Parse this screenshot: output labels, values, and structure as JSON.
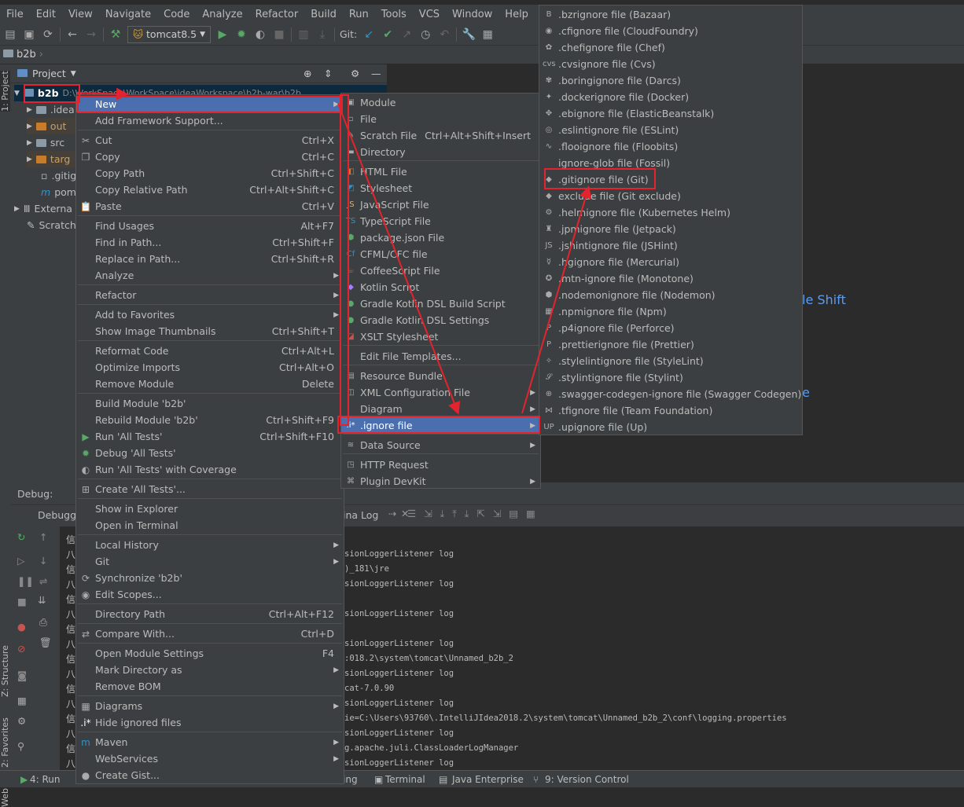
{
  "menubar": [
    "File",
    "Edit",
    "View",
    "Navigate",
    "Code",
    "Analyze",
    "Refactor",
    "Build",
    "Run",
    "Tools",
    "VCS",
    "Window",
    "Help"
  ],
  "toolbar": {
    "run_config": "tomcat8.5",
    "git_label": "Git:"
  },
  "breadcrumb": "b2b",
  "left_tabs": {
    "project": "1: Project",
    "structure": "Z: Structure",
    "favorites": "2: Favorites",
    "web": "Web"
  },
  "project_panel": {
    "title": "Project",
    "root": {
      "name": "b2b",
      "path": "D:\\WorkSpace\\WorkSpace\\ideaWorkspace\\b2b-war\\b2b"
    },
    "items": [
      ".idea",
      "out",
      "src",
      "targ",
      ".gitig",
      "pom",
      "Externa",
      "Scratch"
    ]
  },
  "context_menu": [
    {
      "label": "New",
      "shortcut": "",
      "submenu": true,
      "icon": ""
    },
    {
      "label": "Add Framework Support...",
      "shortcut": "",
      "icon": ""
    },
    {
      "label": "Cut",
      "shortcut": "Ctrl+X",
      "icon": "scissors-icon"
    },
    {
      "label": "Copy",
      "shortcut": "Ctrl+C",
      "icon": "copy-icon"
    },
    {
      "label": "Copy Path",
      "shortcut": "Ctrl+Shift+C",
      "icon": ""
    },
    {
      "label": "Copy Relative Path",
      "shortcut": "Ctrl+Alt+Shift+C",
      "icon": ""
    },
    {
      "label": "Paste",
      "shortcut": "Ctrl+V",
      "icon": "paste-icon"
    },
    {
      "label": "Find Usages",
      "shortcut": "Alt+F7",
      "icon": ""
    },
    {
      "label": "Find in Path...",
      "shortcut": "Ctrl+Shift+F",
      "icon": ""
    },
    {
      "label": "Replace in Path...",
      "shortcut": "Ctrl+Shift+R",
      "icon": ""
    },
    {
      "label": "Analyze",
      "shortcut": "",
      "submenu": true,
      "icon": ""
    },
    {
      "label": "Refactor",
      "shortcut": "",
      "submenu": true,
      "icon": ""
    },
    {
      "label": "Add to Favorites",
      "shortcut": "",
      "submenu": true,
      "icon": ""
    },
    {
      "label": "Show Image Thumbnails",
      "shortcut": "Ctrl+Shift+T",
      "icon": ""
    },
    {
      "label": "Reformat Code",
      "shortcut": "Ctrl+Alt+L",
      "icon": ""
    },
    {
      "label": "Optimize Imports",
      "shortcut": "Ctrl+Alt+O",
      "icon": ""
    },
    {
      "label": "Remove Module",
      "shortcut": "Delete",
      "icon": ""
    },
    {
      "label": "Build Module 'b2b'",
      "shortcut": "",
      "icon": ""
    },
    {
      "label": "Rebuild Module 'b2b'",
      "shortcut": "Ctrl+Shift+F9",
      "icon": ""
    },
    {
      "label": "Run 'All Tests'",
      "shortcut": "Ctrl+Shift+F10",
      "icon": "run-icon"
    },
    {
      "label": "Debug 'All Tests'",
      "shortcut": "",
      "icon": "debug-icon"
    },
    {
      "label": "Run 'All Tests' with Coverage",
      "shortcut": "",
      "icon": "coverage-icon"
    },
    {
      "label": "Create 'All Tests'...",
      "shortcut": "",
      "icon": "create-icon"
    },
    {
      "label": "Show in Explorer",
      "shortcut": "",
      "icon": ""
    },
    {
      "label": "Open in Terminal",
      "shortcut": "",
      "icon": ""
    },
    {
      "label": "Local History",
      "shortcut": "",
      "submenu": true,
      "icon": ""
    },
    {
      "label": "Git",
      "shortcut": "",
      "submenu": true,
      "icon": ""
    },
    {
      "label": "Synchronize 'b2b'",
      "shortcut": "",
      "icon": "sync-icon"
    },
    {
      "label": "Edit Scopes...",
      "shortcut": "",
      "icon": "scope-icon"
    },
    {
      "label": "Directory Path",
      "shortcut": "Ctrl+Alt+F12",
      "icon": ""
    },
    {
      "label": "Compare With...",
      "shortcut": "Ctrl+D",
      "icon": "compare-icon"
    },
    {
      "label": "Open Module Settings",
      "shortcut": "F4",
      "icon": ""
    },
    {
      "label": "Mark Directory as",
      "shortcut": "",
      "submenu": true,
      "icon": ""
    },
    {
      "label": "Remove BOM",
      "shortcut": "",
      "icon": ""
    },
    {
      "label": "Diagrams",
      "shortcut": "",
      "submenu": true,
      "icon": "diagram-icon"
    },
    {
      "label": "Hide ignored files",
      "shortcut": "",
      "icon": "ignore-icon"
    },
    {
      "label": "Maven",
      "shortcut": "",
      "submenu": true,
      "icon": "maven-icon"
    },
    {
      "label": "WebServices",
      "shortcut": "",
      "submenu": true,
      "icon": ""
    },
    {
      "label": "Create Gist...",
      "shortcut": "",
      "icon": "github-icon"
    }
  ],
  "new_menu": [
    {
      "label": "Module",
      "shortcut": "",
      "icon": "module-icon"
    },
    {
      "label": "File",
      "shortcut": "",
      "icon": "file-icon"
    },
    {
      "label": "Scratch File",
      "shortcut": "Ctrl+Alt+Shift+Insert",
      "icon": "scratch-icon"
    },
    {
      "label": "Directory",
      "shortcut": "",
      "icon": "folder-icon"
    },
    {
      "label": "HTML File",
      "shortcut": "",
      "icon": "html-icon"
    },
    {
      "label": "Stylesheet",
      "shortcut": "",
      "icon": "css-icon"
    },
    {
      "label": "JavaScript File",
      "shortcut": "",
      "icon": "js-icon"
    },
    {
      "label": "TypeScript File",
      "shortcut": "",
      "icon": "ts-icon"
    },
    {
      "label": "package.json File",
      "shortcut": "",
      "icon": "npm-icon"
    },
    {
      "label": "CFML/CFC file",
      "shortcut": "",
      "icon": "cf-icon"
    },
    {
      "label": "CoffeeScript File",
      "shortcut": "",
      "icon": "coffee-icon"
    },
    {
      "label": "Kotlin Script",
      "shortcut": "",
      "icon": "kotlin-icon"
    },
    {
      "label": "Gradle Kotlin DSL Build Script",
      "shortcut": "",
      "icon": "gradle-icon"
    },
    {
      "label": "Gradle Kotlin DSL Settings",
      "shortcut": "",
      "icon": "gradle-icon"
    },
    {
      "label": "XSLT Stylesheet",
      "shortcut": "",
      "icon": "xslt-icon"
    },
    {
      "label": "Edit File Templates...",
      "shortcut": "",
      "icon": ""
    },
    {
      "label": "Resource Bundle",
      "shortcut": "",
      "icon": "bundle-icon"
    },
    {
      "label": "XML Configuration File",
      "shortcut": "",
      "submenu": true,
      "icon": "xml-icon"
    },
    {
      "label": "Diagram",
      "shortcut": "",
      "submenu": true,
      "icon": ""
    },
    {
      "label": ".ignore file",
      "shortcut": "",
      "submenu": true,
      "icon": "ignore-icon",
      "selected": true
    },
    {
      "label": "Data Source",
      "shortcut": "",
      "submenu": true,
      "icon": "database-icon"
    },
    {
      "label": "HTTP Request",
      "shortcut": "",
      "icon": "api-icon"
    },
    {
      "label": "Plugin DevKit",
      "shortcut": "",
      "submenu": true,
      "icon": "plugin-icon"
    }
  ],
  "ignore_menu": [
    ".bzrignore file (Bazaar)",
    ".cfignore file (CloudFoundry)",
    ".chefignore file (Chef)",
    ".cvsignore file (Cvs)",
    ".boringignore file (Darcs)",
    ".dockerignore file (Docker)",
    ".ebignore file (ElasticBeanstalk)",
    ".eslintignore file (ESLint)",
    ".flooignore file (Floobits)",
    "ignore-glob file (Fossil)",
    ".gitignore file (Git)",
    "exclude file (Git exclude)",
    ".helmignore file (Kubernetes Helm)",
    ".jpmignore file (Jetpack)",
    ".jshintignore file (JSHint)",
    ".hgignore file (Mercurial)",
    ".mtn-ignore file (Monotone)",
    ".nodemonignore file (Nodemon)",
    ".npmignore file (Npm)",
    ".p4ignore file (Perforce)",
    ".prettierignore file (Prettier)",
    ".stylelintignore file (StyleLint)",
    ".stylintignore file (Stylint)",
    ".swagger-codegen-ignore file (Swagger Codegen)",
    ".tfignore file (Team Foundation)",
    ".upignore file (Up)"
  ],
  "ignore_icons": [
    "B",
    "◉",
    "✿",
    "cvs",
    "✾",
    "✦",
    "✥",
    "◎",
    "∿",
    "",
    "◆",
    "◆",
    "⚙",
    "♜",
    "JS",
    "☿",
    "✪",
    "⬢",
    "▦",
    "P",
    "P",
    "✧",
    "𝒮",
    "⊕",
    "⋈",
    "UP"
  ],
  "editor_hints": {
    "hint1": "le Shift",
    "hint2": "e"
  },
  "debug": {
    "label": "Debug:",
    "tab": "Debugge",
    "log_tab": "ina Log"
  },
  "console_lines": [
    "sionLoggerListener log",
    ")_181\\jre",
    "sionLoggerListener log",
    "",
    "sionLoggerListener log",
    "",
    "sionLoggerListener log",
    ":018.2\\system\\tomcat\\Unnamed_b2b_2",
    "sionLoggerListener log",
    "cat-7.0.90",
    "sionLoggerListener log",
    "ie=C:\\Users\\93760\\.IntelliJIdea2018.2\\system\\tomcat\\Unnamed_b2b_2\\conf\\logging.properties",
    "sionLoggerListener log",
    "g.apache.juli.ClassLoaderLogManager",
    "sionLoggerListener log"
  ],
  "console_prefix": [
    "信",
    "八",
    "信",
    "八",
    "信",
    "八",
    "信",
    "八",
    "信",
    "八",
    "信",
    "八",
    "信",
    "八",
    "信",
    "八"
  ],
  "statusbar": {
    "run": "4: Run",
    "logging": "ing",
    "terminal": "Terminal",
    "java_enterprise": "Java Enterprise",
    "vcs": "9: Version Control"
  },
  "colors": {
    "selection": "#4b6eaf",
    "annotation": "#e3232d",
    "panel": "#3c3f41",
    "editor": "#2b2b2b"
  }
}
